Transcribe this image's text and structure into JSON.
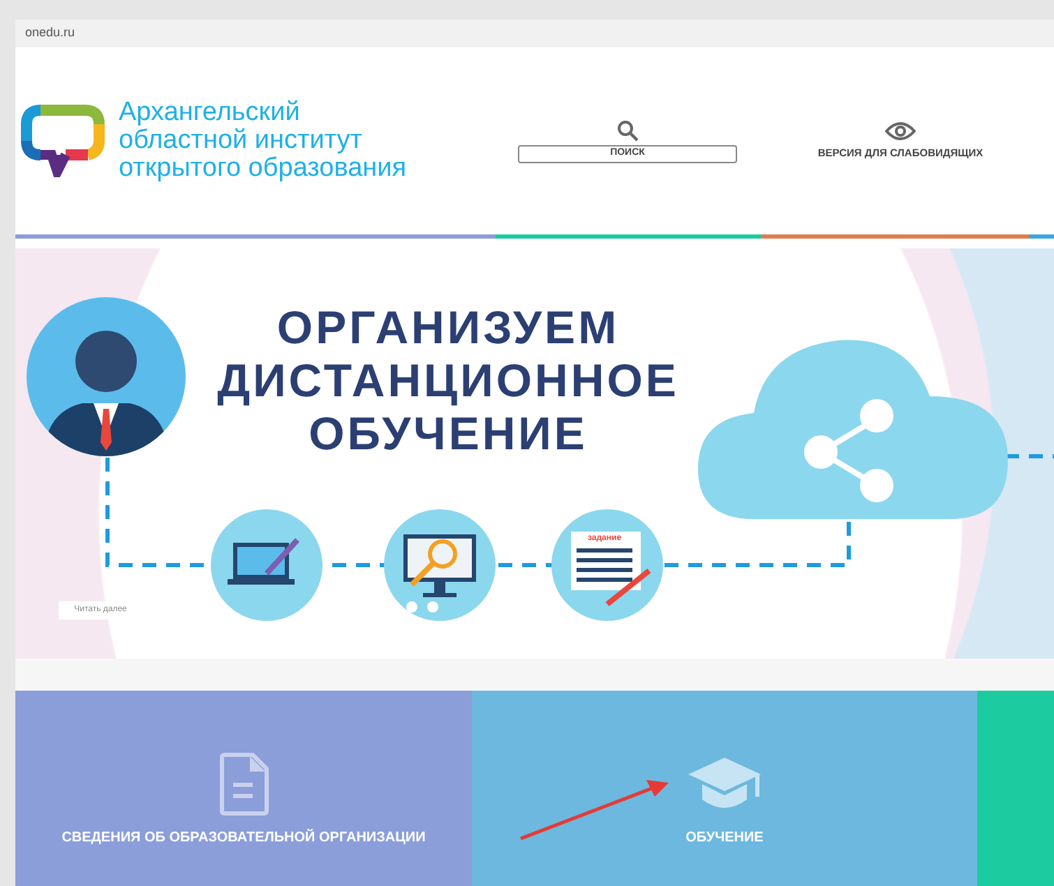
{
  "browser": {
    "address": "onedu.ru"
  },
  "header": {
    "logo_lines": [
      "Архангельский",
      "областной институт",
      "открытого образования"
    ],
    "search": {
      "label": "ПОИСК"
    },
    "accessibility": {
      "label": "ВЕРСИЯ ДЛЯ СЛАБОВИДЯЩИХ"
    }
  },
  "banner": {
    "title_lines": [
      "ОРГАНИЗУЕМ",
      "ДИСТАНЦИОННОЕ",
      "ОБУЧЕНИЕ"
    ],
    "worksheet_label": "задание",
    "read_more": "Читать далее"
  },
  "tiles": [
    {
      "kind": "document",
      "label": "СВЕДЕНИЯ ОБ ОБРАЗОВАТЕЛЬНОЙ ОРГАНИЗАЦИИ",
      "color": "#8b9ed9"
    },
    {
      "kind": "graduation",
      "label": "ОБУЧЕНИЕ",
      "color": "#6cb8df"
    },
    {
      "kind": "blank",
      "color": "#1ccca0"
    }
  ]
}
